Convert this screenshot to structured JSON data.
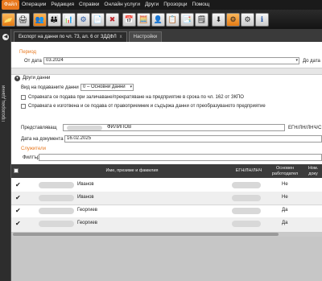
{
  "menu": [
    "Файл",
    "Операции",
    "Редакция",
    "Справки",
    "Онлайн услуги",
    "Други",
    "Прозорци",
    "Помощ"
  ],
  "toolbar": [
    {
      "icon": "folder-open-icon",
      "glyph": "📂"
    },
    {
      "icon": "print-icon",
      "glyph": "🖨"
    },
    {
      "icon": "users-icon",
      "glyph": "👥"
    },
    {
      "icon": "people-icon",
      "glyph": "👪"
    },
    {
      "icon": "chart-icon",
      "glyph": "📊"
    },
    {
      "icon": "settings-doc-icon",
      "glyph": "⚙"
    },
    {
      "icon": "document-icon",
      "glyph": "📄"
    },
    {
      "icon": "close-doc-icon",
      "glyph": "✖"
    },
    {
      "icon": "calendar-icon",
      "glyph": "📅"
    },
    {
      "icon": "calculator-icon",
      "glyph": "🧮"
    },
    {
      "icon": "user-icon",
      "glyph": "👤"
    },
    {
      "icon": "list-icon",
      "glyph": "📋"
    },
    {
      "icon": "clipboard-icon",
      "glyph": "📑"
    },
    {
      "icon": "report-icon",
      "glyph": "🗒"
    },
    {
      "icon": "download-icon",
      "glyph": "⬇"
    },
    {
      "icon": "gear-icon",
      "glyph": "⚙"
    },
    {
      "icon": "gears-icon",
      "glyph": "⚙"
    },
    {
      "icon": "info-icon",
      "glyph": "ℹ"
    }
  ],
  "side_panel": {
    "label": "Прозорец данни"
  },
  "tabs": [
    {
      "label": "Експорт на данни по чл. 73, ал. 6 от ЗДДФЛ",
      "close": "x"
    },
    {
      "label": "Настройки",
      "close": ""
    }
  ],
  "period": {
    "title": "Период",
    "from_label": "От дата",
    "from_value": "03.2024",
    "to_label": "До дата"
  },
  "other_data": {
    "title": "Други данни",
    "submission_label": "Вид на подаваните данни",
    "submission_value": "0 – Основни данни",
    "check1": "Справката се подава при заличаване/прекратяване на предприятие в срока по чл. 162 от ЗКПО",
    "check2": "Справката е изготвена и се подава от правоприемник и съдържа данни от преобразуваното предприятие"
  },
  "representative": {
    "label": "Представляващ",
    "value": "ФИЛИПОВ",
    "id_label": "ЕГН/ЛН/ЛНЧ/С",
    "date_label": "Дата на документа",
    "date_value": "16.02.2025"
  },
  "employees": {
    "title": "Служители",
    "filter_label": "Филтър",
    "columns": {
      "name": "Име, презиме и фамилия",
      "id": "ЕГН/ЛН/ЛНЧ",
      "main_employer": "Основен работодател",
      "doc": "Ном. доку"
    },
    "rows": [
      {
        "surname": "Иванов",
        "main": "Не",
        "checked": "✔"
      },
      {
        "surname": "Иванов",
        "main": "Не",
        "checked": "✔"
      },
      {
        "surname": "Георгиев",
        "main": "Да",
        "checked": "✔"
      },
      {
        "surname": "Георгиев",
        "main": "Да",
        "checked": "✔"
      }
    ]
  },
  "colors": {
    "accent": "#e8781e",
    "dark": "#1a1a1a",
    "header": "#3b3b3b"
  }
}
